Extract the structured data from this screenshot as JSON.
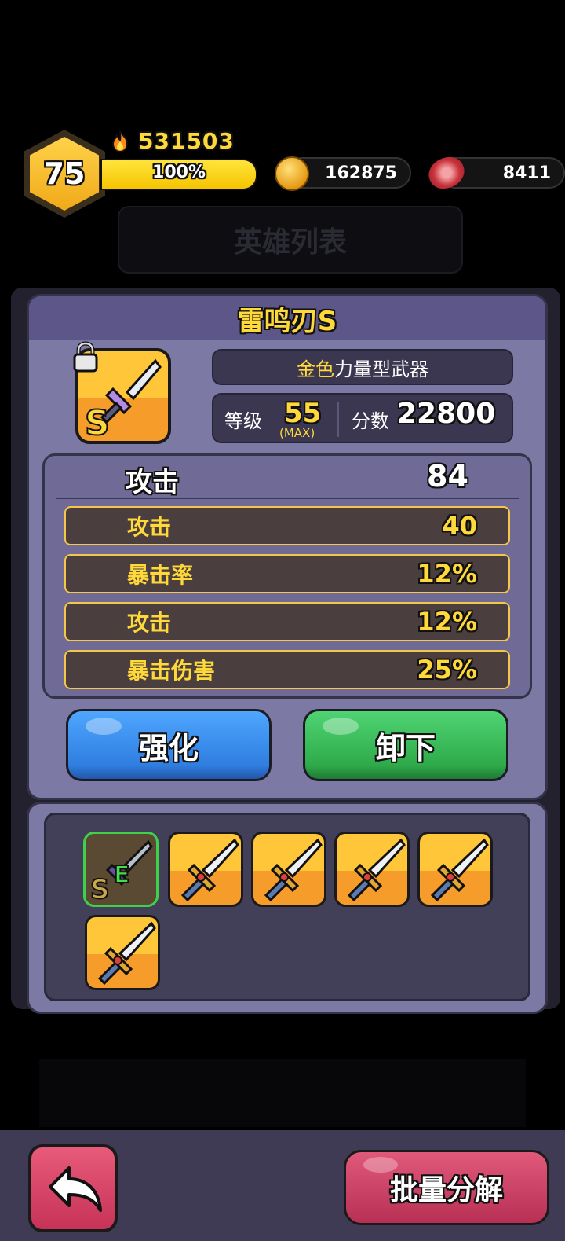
{
  "header": {
    "level": "75",
    "power": "531503",
    "xp_percent_label": "100%",
    "xp_fraction": 1.0,
    "coins": "162875",
    "meat": "8411",
    "bg_title": "英雄列表"
  },
  "item": {
    "name": "雷鸣刃S",
    "rarity": "金色",
    "type": "力量型武器",
    "level_label": "等级",
    "level_value": "55",
    "level_max": "(MAX)",
    "score_label": "分数",
    "score_value": "22800",
    "badge_letter": "S"
  },
  "stats": {
    "main_label": "攻击",
    "main_value": "84",
    "rows": [
      {
        "label": "攻击",
        "value": "40"
      },
      {
        "label": "暴击率",
        "value": "12%"
      },
      {
        "label": "攻击",
        "value": "12%"
      },
      {
        "label": "暴击伤害",
        "value": "25%"
      }
    ]
  },
  "buttons": {
    "enhance": "强化",
    "unequip": "卸下",
    "batch_dismantle": "批量分解"
  },
  "inventory": {
    "equipped_badge": "E"
  },
  "colors": {
    "accent_gold": "#ffd83a",
    "panel": "#7d79a5",
    "blue_button": "#2f7ee0",
    "green_button": "#2faa4a",
    "pink_button": "#c63357"
  }
}
